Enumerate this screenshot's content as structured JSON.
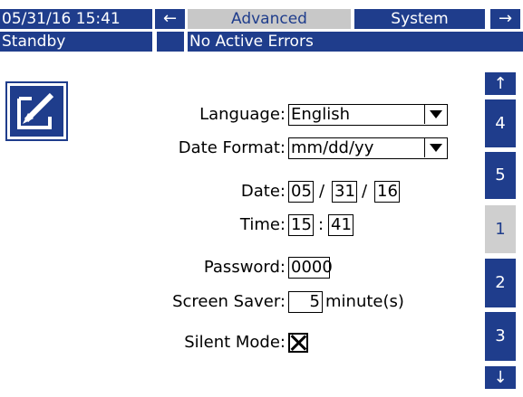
{
  "header": {
    "datetime": "05/31/16 15:41",
    "left_arrow": "←",
    "tab_advanced": "Advanced",
    "tab_system": "System",
    "right_arrow": "→"
  },
  "status": {
    "mode": "Standby",
    "errors": "No Active Errors"
  },
  "form": {
    "language_label": "Language:",
    "language_value": "English",
    "date_format_label": "Date Format:",
    "date_format_value": "mm/dd/yy",
    "date_label": "Date:",
    "date_month": "05",
    "date_day": "31",
    "date_year": "16",
    "date_sep": "/",
    "time_label": "Time:",
    "time_hour": "15",
    "time_minute": "41",
    "time_sep": ":",
    "password_label": "Password:",
    "password_value": "0000",
    "screensaver_label": "Screen Saver:",
    "screensaver_value": "5",
    "screensaver_unit": "minute(s)",
    "silent_label": "Silent Mode:",
    "silent_checked": true
  },
  "side_nav": {
    "up_arrow": "↑",
    "items": [
      "4",
      "5",
      "1",
      "2",
      "3"
    ],
    "active": "1",
    "down_arrow": "↓"
  },
  "colors": {
    "primary": "#1f3d8c",
    "inactive": "#c8c8c8"
  }
}
